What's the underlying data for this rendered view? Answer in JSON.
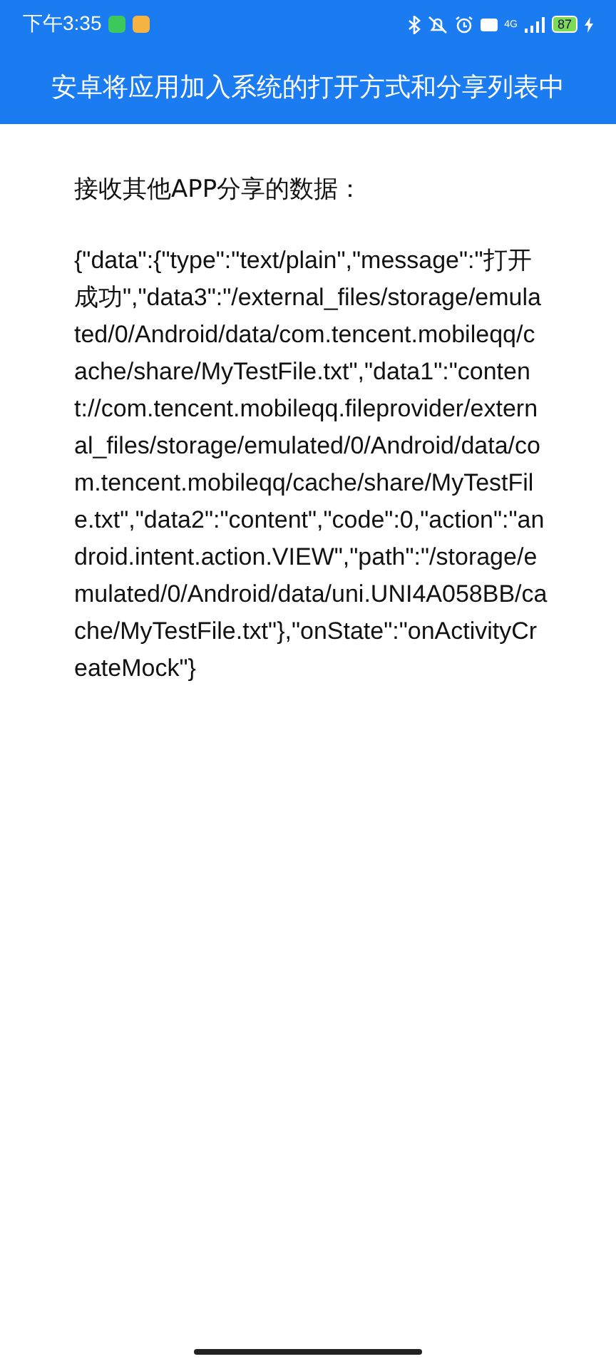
{
  "status_bar": {
    "time": "下午3:35",
    "network": "4G",
    "battery": "87"
  },
  "header": {
    "title": "安卓将应用加入系统的打开方式和分享列表中"
  },
  "content": {
    "label": "接收其他APP分享的数据：",
    "data": "{\"data\":{\"type\":\"text/plain\",\"message\":\"打开成功\",\"data3\":\"/external_files/storage/emulated/0/Android/data/com.tencent.mobileqq/cache/share/MyTestFile.txt\",\"data1\":\"content://com.tencent.mobileqq.fileprovider/external_files/storage/emulated/0/Android/data/com.tencent.mobileqq/cache/share/MyTestFile.txt\",\"data2\":\"content\",\"code\":0,\"action\":\"android.intent.action.VIEW\",\"path\":\"/storage/emulated/0/Android/data/uni.UNI4A058BB/cache/MyTestFile.txt\"},\"onState\":\"onActivityCreateMock\"}"
  }
}
